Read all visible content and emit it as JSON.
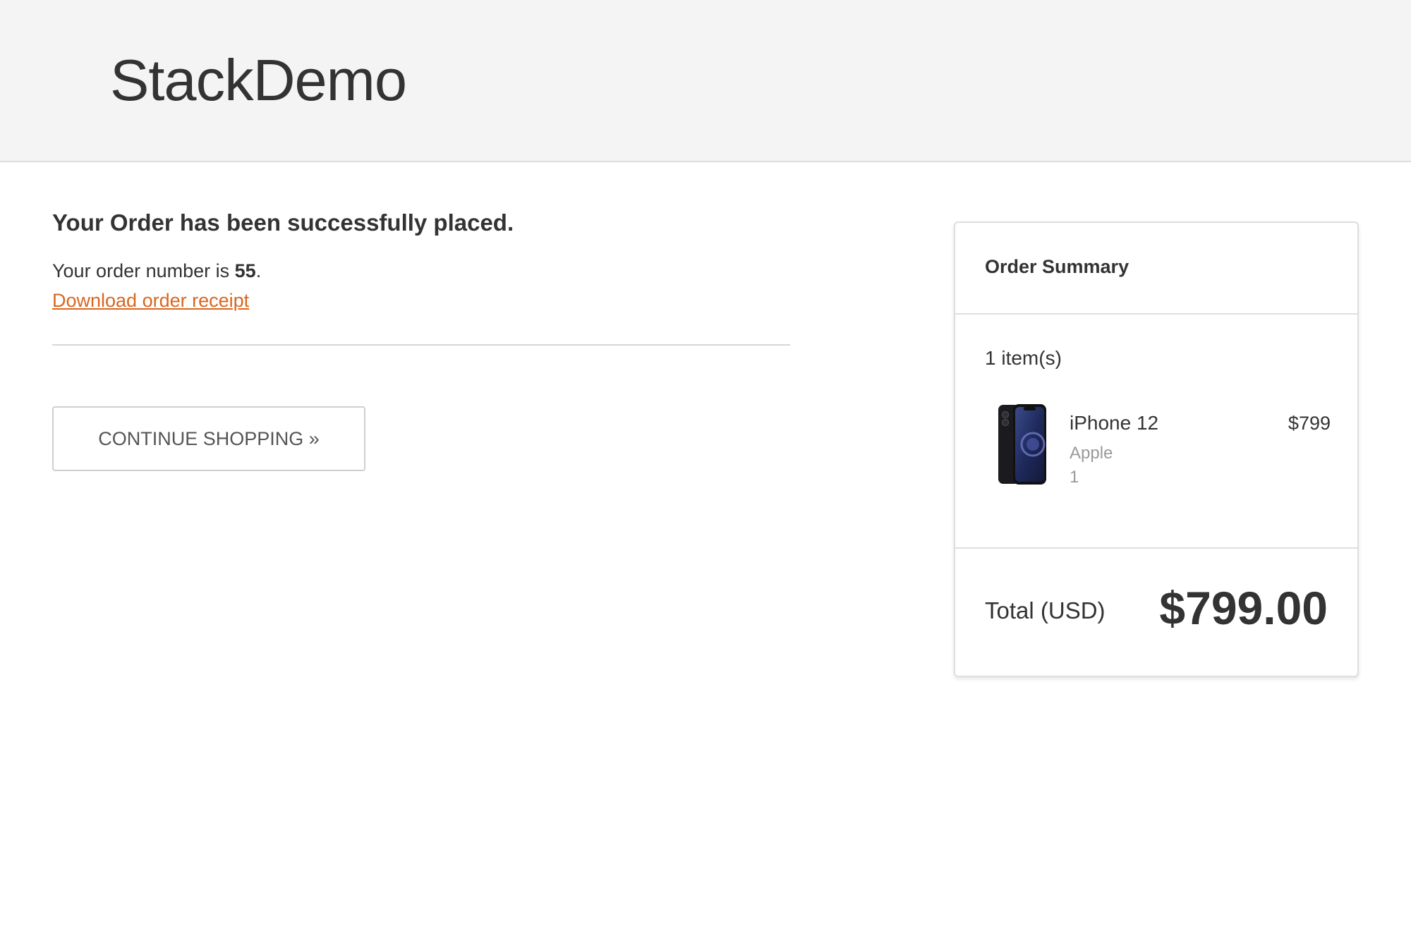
{
  "header": {
    "brand": "StackDemo"
  },
  "confirmation": {
    "title": "Your Order has been successfully placed.",
    "order_number_prefix": "Your order number is ",
    "order_number": "55",
    "order_number_suffix": ".",
    "receipt_link": "Download order receipt",
    "continue_button": "CONTINUE SHOPPING »"
  },
  "summary": {
    "title": "Order Summary",
    "items_count": "1 item(s)",
    "items": [
      {
        "name": "iPhone 12",
        "brand": "Apple",
        "quantity": "1",
        "price": "$799",
        "image_icon": "iphone-12-product-image"
      }
    ],
    "total_label": "Total (USD)",
    "total_value": "$799.00"
  },
  "colors": {
    "header_bg": "#f4f4f4",
    "link": "#d9661f",
    "text": "#333333",
    "muted": "#9a9a9a"
  }
}
